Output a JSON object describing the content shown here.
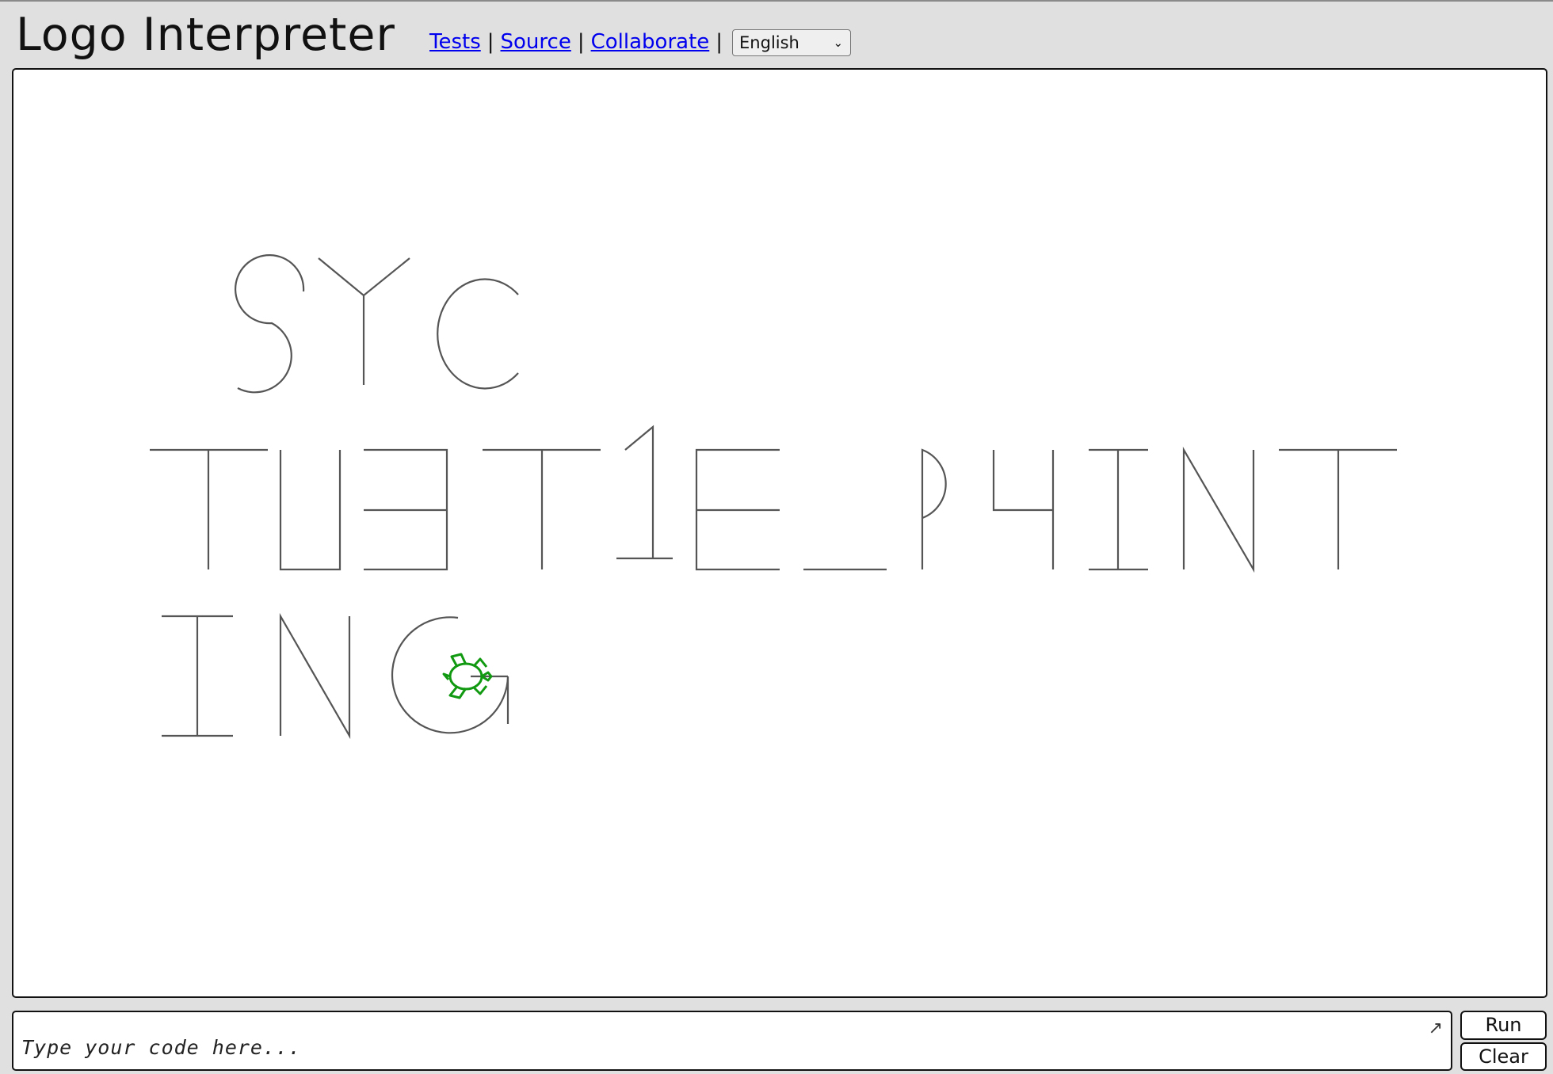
{
  "app": {
    "title": "Logo Interpreter"
  },
  "nav": {
    "links": [
      {
        "label": "Tests"
      },
      {
        "label": "Source"
      },
      {
        "label": "Collaborate"
      }
    ],
    "separator": "|"
  },
  "language_select": {
    "selected": "English"
  },
  "canvas": {
    "pen_color": "#555555",
    "turtle_color": "#119911"
  },
  "code_editor": {
    "value": "",
    "placeholder": "Type your code here..."
  },
  "buttons": {
    "run": "Run",
    "clear": "Clear"
  }
}
